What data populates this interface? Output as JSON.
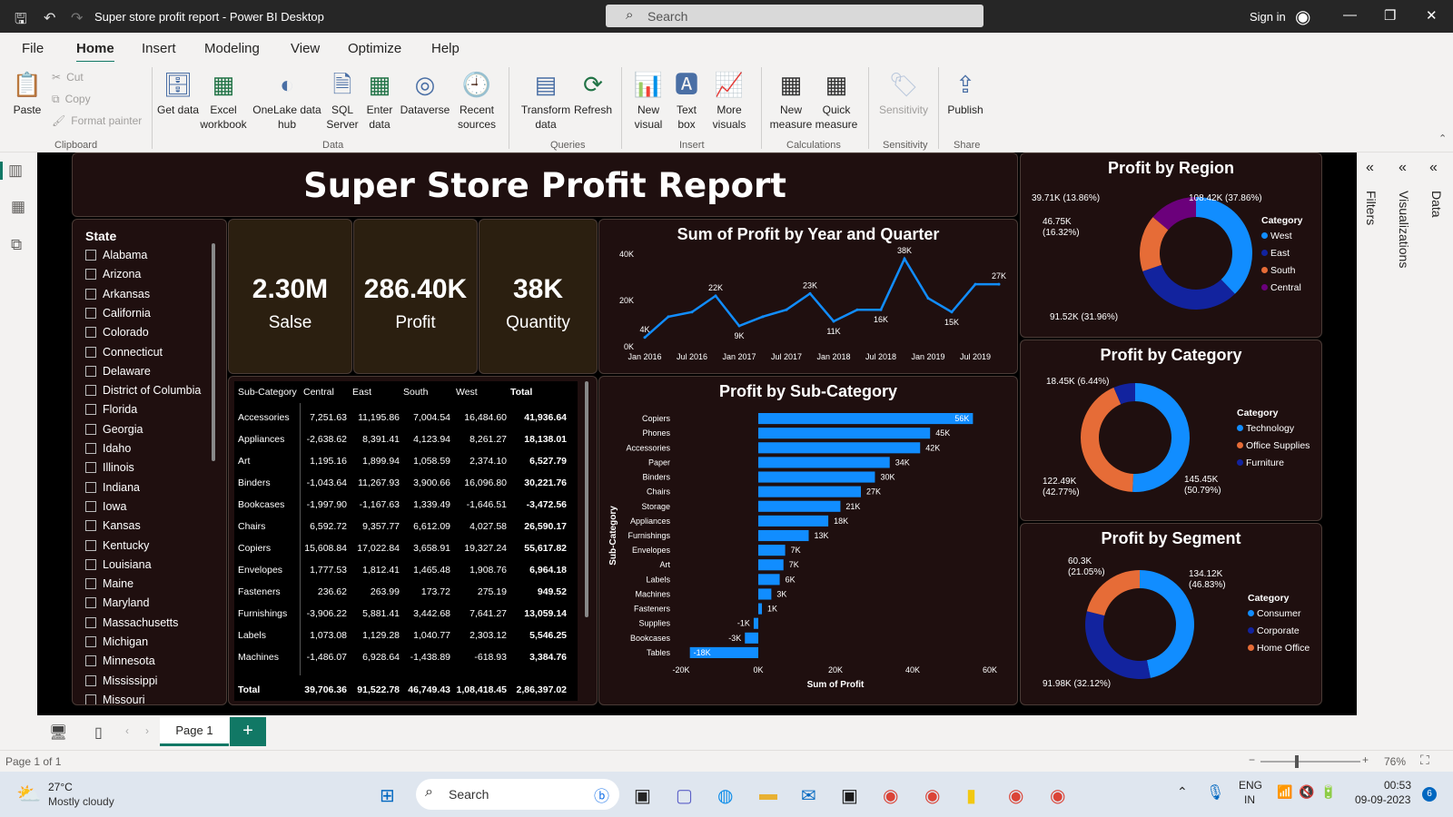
{
  "window": {
    "title": "Super store profit report - Power BI Desktop",
    "search_placeholder": "Search",
    "sign_in": "Sign in"
  },
  "menu": [
    "File",
    "Home",
    "Insert",
    "Modeling",
    "View",
    "Optimize",
    "Help"
  ],
  "ribbon": {
    "clipboard": {
      "paste": "Paste",
      "cut": "Cut",
      "copy": "Copy",
      "format_painter": "Format painter",
      "group": "Clipboard"
    },
    "data": {
      "get_data": "Get data",
      "excel": "Excel workbook",
      "onelake": "OneLake data hub",
      "sql": "SQL Server",
      "enter_data": "Enter data",
      "dataverse": "Dataverse",
      "recent": "Recent sources",
      "group": "Data"
    },
    "queries": {
      "transform": "Transform data",
      "refresh": "Refresh",
      "group": "Queries"
    },
    "insert": {
      "new_visual": "New visual",
      "text_box": "Text box",
      "more_visuals": "More visuals",
      "group": "Insert"
    },
    "calculations": {
      "new_measure": "New measure",
      "quick_measure": "Quick measure",
      "group": "Calculations"
    },
    "sensitivity": {
      "label": "Sensitivity",
      "group": "Sensitivity"
    },
    "share": {
      "publish": "Publish",
      "group": "Share"
    }
  },
  "report": {
    "title": "Super Store Profit Report",
    "kpis": [
      {
        "value": "2.30M",
        "label": "Salse"
      },
      {
        "value": "286.40K",
        "label": "Profit"
      },
      {
        "value": "38K",
        "label": "Quantity"
      }
    ],
    "slicer": {
      "header": "State",
      "items": [
        "Alabama",
        "Arizona",
        "Arkansas",
        "California",
        "Colorado",
        "Connecticut",
        "Delaware",
        "District of Columbia",
        "Florida",
        "Georgia",
        "Idaho",
        "Illinois",
        "Indiana",
        "Iowa",
        "Kansas",
        "Kentucky",
        "Louisiana",
        "Maine",
        "Maryland",
        "Massachusetts",
        "Michigan",
        "Minnesota",
        "Mississippi",
        "Missouri"
      ]
    },
    "table": {
      "headers": [
        "Sub-Category",
        "Central",
        "East",
        "South",
        "West",
        "Total"
      ],
      "rows": [
        [
          "Accessories",
          "7,251.63",
          "11,195.86",
          "7,004.54",
          "16,484.60",
          "41,936.64"
        ],
        [
          "Appliances",
          "-2,638.62",
          "8,391.41",
          "4,123.94",
          "8,261.27",
          "18,138.01"
        ],
        [
          "Art",
          "1,195.16",
          "1,899.94",
          "1,058.59",
          "2,374.10",
          "6,527.79"
        ],
        [
          "Binders",
          "-1,043.64",
          "11,267.93",
          "3,900.66",
          "16,096.80",
          "30,221.76"
        ],
        [
          "Bookcases",
          "-1,997.90",
          "-1,167.63",
          "1,339.49",
          "-1,646.51",
          "-3,472.56"
        ],
        [
          "Chairs",
          "6,592.72",
          "9,357.77",
          "6,612.09",
          "4,027.58",
          "26,590.17"
        ],
        [
          "Copiers",
          "15,608.84",
          "17,022.84",
          "3,658.91",
          "19,327.24",
          "55,617.82"
        ],
        [
          "Envelopes",
          "1,777.53",
          "1,812.41",
          "1,465.48",
          "1,908.76",
          "6,964.18"
        ],
        [
          "Fasteners",
          "236.62",
          "263.99",
          "173.72",
          "275.19",
          "949.52"
        ],
        [
          "Furnishings",
          "-3,906.22",
          "5,881.41",
          "3,442.68",
          "7,641.27",
          "13,059.14"
        ],
        [
          "Labels",
          "1,073.08",
          "1,129.28",
          "1,040.77",
          "2,303.12",
          "5,546.25"
        ],
        [
          "Machines",
          "-1,486.07",
          "6,928.64",
          "-1,438.89",
          "-618.93",
          "3,384.76"
        ]
      ],
      "total": [
        "Total",
        "39,706.36",
        "91,522.78",
        "46,749.43",
        "1,08,418.45",
        "2,86,397.02"
      ]
    },
    "profit_by_region": {
      "title": "Profit by Region",
      "legend_title": "Category",
      "labels": {
        "west": "108.42K (37.86%)",
        "east": "91.52K (31.96%)",
        "south": "46.75K (16.32%)",
        "central": "39.71K (13.86%)"
      }
    },
    "profit_by_category": {
      "title": "Profit by Category",
      "legend_title": "Category",
      "labels": {
        "technology": "145.45K (50.79%)",
        "office": "122.49K (42.77%)",
        "furniture": "18.45K (6.44%)"
      }
    },
    "profit_by_segment": {
      "title": "Profit by Segment",
      "legend_title": "Category",
      "labels": {
        "consumer": "134.12K (46.83%)",
        "corporate": "91.98K (32.12%)",
        "home": "60.3K (21.05%)"
      }
    }
  },
  "chart_data": [
    {
      "type": "line",
      "title": "Sum of Profit by Year and Quarter",
      "x": [
        "Jan 2016",
        "Apr 2016",
        "Jul 2016",
        "Oct 2016",
        "Jan 2017",
        "Apr 2017",
        "Jul 2017",
        "Oct 2017",
        "Jan 2018",
        "Apr 2018",
        "Jul 2018",
        "Oct 2018",
        "Jan 2019",
        "Apr 2019",
        "Jul 2019",
        "Oct 2019"
      ],
      "x_tick_labels": [
        "Jan 2016",
        "Jul 2016",
        "Jan 2017",
        "Jul 2017",
        "Jan 2018",
        "Jul 2018",
        "Jan 2019",
        "Jul 2019"
      ],
      "values": [
        4000,
        13000,
        15000,
        22000,
        9000,
        13000,
        16000,
        23000,
        11000,
        16000,
        16000,
        38000,
        21000,
        15000,
        27000,
        27000
      ],
      "data_labels": [
        {
          "i": 0,
          "text": "4K"
        },
        {
          "i": 3,
          "text": "22K"
        },
        {
          "i": 4,
          "text": "9K"
        },
        {
          "i": 7,
          "text": "23K"
        },
        {
          "i": 8,
          "text": "11K"
        },
        {
          "i": 10,
          "text": "16K"
        },
        {
          "i": 11,
          "text": "38K"
        },
        {
          "i": 13,
          "text": "15K"
        },
        {
          "i": 15,
          "text": "27K"
        }
      ],
      "y_ticks": [
        "0K",
        "20K",
        "40K"
      ],
      "ylim": [
        0,
        40000
      ],
      "color": "#118dff"
    },
    {
      "type": "bar",
      "orientation": "horizontal",
      "title": "Profit by Sub-Category",
      "ylabel": "Sub-Category",
      "xlabel": "Sum of Profit",
      "categories": [
        "Copiers",
        "Phones",
        "Accessories",
        "Paper",
        "Binders",
        "Chairs",
        "Storage",
        "Appliances",
        "Furnishings",
        "Envelopes",
        "Art",
        "Labels",
        "Machines",
        "Fasteners",
        "Supplies",
        "Bookcases",
        "Tables"
      ],
      "values": [
        55617.82,
        44515.73,
        41936.64,
        34053.57,
        30221.76,
        26590.17,
        21278.83,
        18138.01,
        13059.14,
        6964.18,
        6527.79,
        5546.25,
        3384.76,
        949.52,
        -1189.1,
        -3472.56,
        -17725.48
      ],
      "data_labels": [
        "56K",
        "45K",
        "42K",
        "34K",
        "30K",
        "27K",
        "21K",
        "18K",
        "13K",
        "7K",
        "7K",
        "6K",
        "3K",
        "1K",
        "-1K",
        "-3K",
        "-18K"
      ],
      "x_ticks": [
        "-20K",
        "0K",
        "20K",
        "40K",
        "60K"
      ],
      "xlim": [
        -20000,
        60000
      ],
      "color": "#118dff"
    },
    {
      "type": "pie",
      "title": "Profit by Region",
      "categories": [
        "West",
        "East",
        "South",
        "Central"
      ],
      "values": [
        108420,
        91520,
        46750,
        39710
      ],
      "colors": [
        "#118dff",
        "#12239e",
        "#e66c37",
        "#6b007b"
      ]
    },
    {
      "type": "pie",
      "title": "Profit by Category",
      "categories": [
        "Technology",
        "Office Supplies",
        "Furniture"
      ],
      "values": [
        145450,
        122490,
        18450
      ],
      "colors": [
        "#118dff",
        "#e66c37",
        "#12239e"
      ]
    },
    {
      "type": "pie",
      "title": "Profit by Segment",
      "categories": [
        "Consumer",
        "Corporate",
        "Home Office"
      ],
      "values": [
        134120,
        91980,
        60300
      ],
      "colors": [
        "#118dff",
        "#12239e",
        "#e66c37"
      ]
    }
  ],
  "side_panes": {
    "filters": "Filters",
    "visualizations": "Visualizations",
    "data": "Data"
  },
  "pages": {
    "tab": "Page 1",
    "add": "+",
    "status": "Page 1 of 1",
    "zoom": "76%"
  },
  "taskbar": {
    "weather_temp": "27°C",
    "weather_desc": "Mostly cloudy",
    "search": "Search",
    "lang1": "ENG",
    "lang2": "IN",
    "time": "00:53",
    "date": "09-09-2023",
    "notif": "6"
  }
}
